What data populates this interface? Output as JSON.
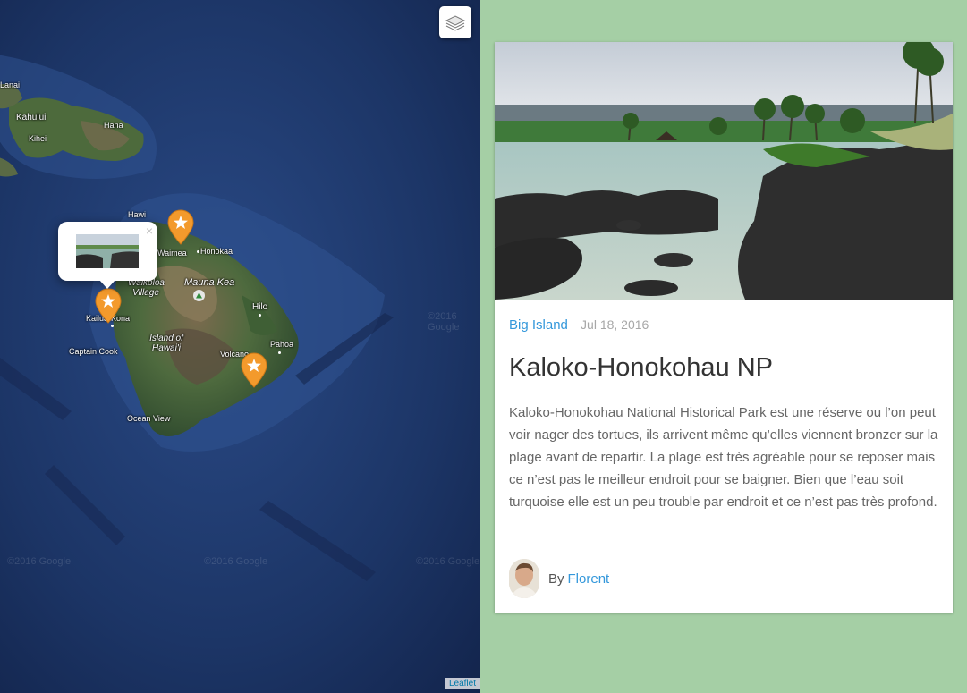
{
  "map": {
    "labels": {
      "lanai": "Lanai",
      "kahului": "Kahului",
      "hana": "Hana",
      "kihei": "Kihei",
      "hawi": "Hawi",
      "waimea": "Waimea",
      "honokaa": "Honokaa",
      "waikoloa": "Waikoloa Village",
      "mauna_kea": "Mauna Kea",
      "kailua_kona": "Kailua-Kona",
      "hilo": "Hilo",
      "island": "Island of Hawai'i",
      "captain_cook": "Captain Cook",
      "volcano": "Volcano",
      "pahoa": "Pahoa",
      "ocean_view": "Ocean View"
    },
    "watermark": "©2016 Google",
    "attribution": "Leaflet",
    "marker_color": "#f39a2c",
    "icons": [
      "layers-icon",
      "star-icon",
      "close-icon",
      "park-icon"
    ]
  },
  "popup": {
    "close_label": "×"
  },
  "card": {
    "category": "Big Island",
    "date": "Jul 18, 2016",
    "title": "Kaloko-Honokohau NP",
    "body": "Kaloko-Honokohau National Historical Park est une réserve ou l’on peut voir nager des tortues, ils arrivent même qu’elles viennent bronzer sur la plage avant de repartir. La plage est très agréable pour se reposer mais ce n’est pas le meilleur endroit pour se baigner. Bien que l’eau soit turquoise elle est un peu trouble par endroit et ce n’est pas très profond.",
    "author_prefix": "By",
    "author_name": "Florent"
  },
  "colors": {
    "accent": "#3498db",
    "background": "#a5cfa5",
    "ocean": "#1d3566"
  }
}
